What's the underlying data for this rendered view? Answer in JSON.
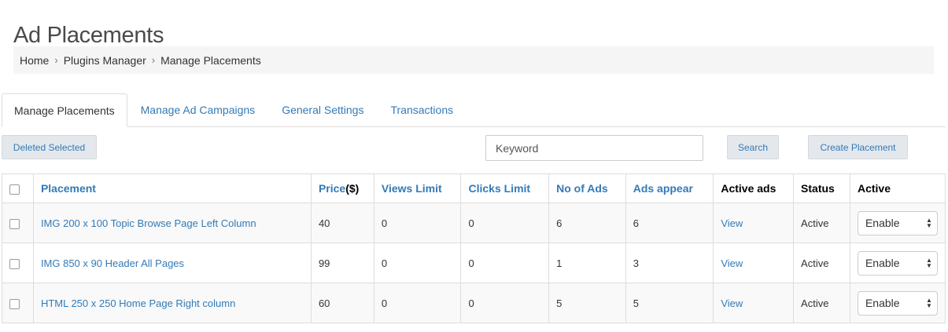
{
  "page": {
    "title": "Ad Placements"
  },
  "breadcrumb": [
    "Home",
    "Plugins Manager",
    "Manage Placements"
  ],
  "tabs": [
    {
      "label": "Manage Placements",
      "active": true
    },
    {
      "label": "Manage Ad Campaigns",
      "active": false
    },
    {
      "label": "General Settings",
      "active": false
    },
    {
      "label": "Transactions",
      "active": false
    }
  ],
  "toolbar": {
    "delete_label": "Deleted Selected",
    "keyword_placeholder": "Keyword",
    "keyword_value": "",
    "search_label": "Search",
    "create_label": "Create Placement"
  },
  "table": {
    "headers": {
      "placement": "Placement",
      "price": "Price",
      "price_unit": "($)",
      "views": "Views Limit",
      "clicks": "Clicks Limit",
      "ads": "No of Ads",
      "appear": "Ads appear",
      "active_ads": "Active ads",
      "status": "Status",
      "active": "Active"
    },
    "rows": [
      {
        "placement": "IMG 200 x 100 Topic Browse Page Left Column",
        "price": "40",
        "views": "0",
        "clicks": "0",
        "ads": "6",
        "appear": "6",
        "active_ads": "View",
        "status": "Active",
        "active": "Enable"
      },
      {
        "placement": "IMG 850 x 90 Header All Pages",
        "price": "99",
        "views": "0",
        "clicks": "0",
        "ads": "1",
        "appear": "3",
        "active_ads": "View",
        "status": "Active",
        "active": "Enable"
      },
      {
        "placement": "HTML 250 x 250 Home Page Right column",
        "price": "60",
        "views": "0",
        "clicks": "0",
        "ads": "5",
        "appear": "5",
        "active_ads": "View",
        "status": "Active",
        "active": "Enable"
      }
    ]
  },
  "colors": {
    "link": "#337ab7",
    "button_bg": "#e4e8ec",
    "breadcrumb_bg": "#f5f5f5",
    "border": "#dddddd"
  },
  "icons": {
    "breadcrumb_separator": "chevron-right-icon",
    "select_caret": "updown-caret-icon"
  }
}
